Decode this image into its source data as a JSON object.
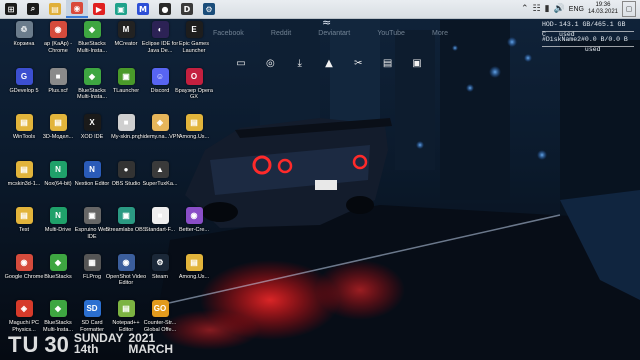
{
  "taskbar": {
    "buttons": [
      {
        "name": "start-button",
        "glyph": "⊞",
        "color": "#1b1b1b"
      },
      {
        "name": "search-button",
        "glyph": "⌕",
        "color": "#1b1b1b"
      },
      {
        "name": "taskbar-file-explorer",
        "glyph": "▤",
        "color": "#e0b03a"
      },
      {
        "name": "taskbar-chrome",
        "glyph": "◉",
        "color": "#d94a3b"
      },
      {
        "name": "taskbar-youtube",
        "glyph": "▶",
        "color": "#e02020"
      },
      {
        "name": "taskbar-app-green",
        "glyph": "▣",
        "color": "#1fa28b"
      },
      {
        "name": "taskbar-app-m",
        "glyph": "M",
        "color": "#2d4fd6"
      },
      {
        "name": "taskbar-obs",
        "glyph": "●",
        "color": "#2a2a2a"
      },
      {
        "name": "taskbar-app-db",
        "glyph": "D",
        "color": "#3a3a3a"
      },
      {
        "name": "taskbar-steam",
        "glyph": "⚙",
        "color": "#1b4d7a"
      }
    ],
    "tray": {
      "lang": "ENG",
      "time": "19:36",
      "date": "14.03.2021"
    }
  },
  "links": [
    "Facebook",
    "Reddit",
    "Deviantart",
    "YouTube",
    "More"
  ],
  "quick_icons": [
    "monitor-icon",
    "chrome-icon",
    "download-icon",
    "vlc-icon",
    "scissors-icon",
    "notepad-icon",
    "window-icon"
  ],
  "disks": [
    {
      "label": "HOD-C",
      "value": "143.1 GB/465.1 GB used"
    },
    {
      "label": "#DiskName2#",
      "value": "0.0 B/0.0 B used"
    }
  ],
  "desktop_icons": [
    {
      "label": "Корзина",
      "glyph": "♲",
      "bg": "#6b7c8c",
      "col": 0,
      "row": 0
    },
    {
      "label": "ap (KaAp) - Chrome",
      "glyph": "◉",
      "bg": "#d54b3c",
      "col": 1,
      "row": 0
    },
    {
      "label": "BlueStacks Multi-Insta...",
      "glyph": "◆",
      "bg": "#3ea641",
      "col": 2,
      "row": 0
    },
    {
      "label": "MCreator",
      "glyph": "M",
      "bg": "#222",
      "col": 3,
      "row": 0
    },
    {
      "label": "Eclipse IDE for Java De...",
      "glyph": "◐",
      "bg": "#2c2255",
      "col": 4,
      "row": 0
    },
    {
      "label": "Epic Games Launcher",
      "glyph": "E",
      "bg": "#1d1d1d",
      "col": 5,
      "row": 0
    },
    {
      "label": "GDevelop 5",
      "glyph": "G",
      "bg": "#3c4fd0",
      "col": 0,
      "row": 1
    },
    {
      "label": "Plus.xcf",
      "glyph": "■",
      "bg": "#8a8a8a",
      "col": 1,
      "row": 1
    },
    {
      "label": "BlueStacks Multi-Insta...",
      "glyph": "◆",
      "bg": "#3ea641",
      "col": 2,
      "row": 1
    },
    {
      "label": "TLauncher",
      "glyph": "▣",
      "bg": "#4a9a2a",
      "col": 3,
      "row": 1
    },
    {
      "label": "Discord",
      "glyph": "☺",
      "bg": "#5865f2",
      "col": 4,
      "row": 1
    },
    {
      "label": "Браузер Opera GX",
      "glyph": "O",
      "bg": "#c4203f",
      "col": 5,
      "row": 1
    },
    {
      "label": "WinTools",
      "glyph": "▤",
      "bg": "#e2b43b",
      "col": 0,
      "row": 2
    },
    {
      "label": "3D-Модел...",
      "glyph": "▤",
      "bg": "#e2b43b",
      "col": 1,
      "row": 2
    },
    {
      "label": "XOD IDE",
      "glyph": "X",
      "bg": "#1a1a1a",
      "col": 2,
      "row": 2
    },
    {
      "label": "My-skin.png",
      "glyph": "■",
      "bg": "#cfcfcf",
      "col": 3,
      "row": 2
    },
    {
      "label": "hidemy.na...VPN",
      "glyph": "◈",
      "bg": "#e6b55a",
      "col": 4,
      "row": 2
    },
    {
      "label": "Among.Us...",
      "glyph": "▤",
      "bg": "#e2b43b",
      "col": 5,
      "row": 2
    },
    {
      "label": "mcskin3d-1...",
      "glyph": "▤",
      "bg": "#e2b43b",
      "col": 0,
      "row": 3
    },
    {
      "label": "Nox(64-bit)",
      "glyph": "N",
      "bg": "#1fa16a",
      "col": 1,
      "row": 3
    },
    {
      "label": "Nextion Editor",
      "glyph": "N",
      "bg": "#2a5bb8",
      "col": 2,
      "row": 3
    },
    {
      "label": "OBS Studio",
      "glyph": "●",
      "bg": "#333",
      "col": 3,
      "row": 3
    },
    {
      "label": "SuperTuxKa...",
      "glyph": "▲",
      "bg": "#3a3a3a",
      "col": 4,
      "row": 3
    },
    {
      "label": "Test",
      "glyph": "▤",
      "bg": "#e2b43b",
      "col": 0,
      "row": 4
    },
    {
      "label": "Multi-Drive",
      "glyph": "N",
      "bg": "#1fa16a",
      "col": 1,
      "row": 4
    },
    {
      "label": "Espruino Web IDE",
      "glyph": "▣",
      "bg": "#666",
      "col": 2,
      "row": 4
    },
    {
      "label": "Streamlabs OBS",
      "glyph": "▣",
      "bg": "#2b9a83",
      "col": 3,
      "row": 4
    },
    {
      "label": "Standart-F...",
      "glyph": "■",
      "bg": "#eee",
      "col": 4,
      "row": 4
    },
    {
      "label": "Better-Cre...",
      "glyph": "◉",
      "bg": "#8a4ec7",
      "col": 5,
      "row": 4
    },
    {
      "label": "Google Chrome",
      "glyph": "◉",
      "bg": "#d54b3c",
      "col": 0,
      "row": 5
    },
    {
      "label": "BlueStacks",
      "glyph": "◆",
      "bg": "#3ea641",
      "col": 1,
      "row": 5
    },
    {
      "label": "FLProg",
      "glyph": "▦",
      "bg": "#555",
      "col": 2,
      "row": 5
    },
    {
      "label": "OpenShot Video Editor",
      "glyph": "◉",
      "bg": "#3b5e9c",
      "col": 3,
      "row": 5
    },
    {
      "label": "Steam",
      "glyph": "⚙",
      "bg": "#1b2838",
      "col": 4,
      "row": 5
    },
    {
      "label": "Among.Us...",
      "glyph": "▤",
      "bg": "#e2b43b",
      "col": 5,
      "row": 5
    },
    {
      "label": "Maguchi PC Physics...",
      "glyph": "◈",
      "bg": "#d63a2a",
      "col": 0,
      "row": 6
    },
    {
      "label": "BlueStacks Multi-Insta...",
      "glyph": "◆",
      "bg": "#3ea641",
      "col": 1,
      "row": 6
    },
    {
      "label": "SD Card Formatter",
      "glyph": "SD",
      "bg": "#2b6fd0",
      "col": 2,
      "row": 6
    },
    {
      "label": "Notepad++ Editor",
      "glyph": "▤",
      "bg": "#7cb342",
      "col": 3,
      "row": 6
    },
    {
      "label": "Counter-Str... Global Offe...",
      "glyph": "GO",
      "bg": "#e29a1d",
      "col": 4,
      "row": 6
    }
  ],
  "date_widget": {
    "day_abbr": "TU",
    "day_num": "30",
    "weekday": "SUNDAY",
    "ordinal": "14th",
    "year": "2021",
    "month": "MARCH"
  }
}
